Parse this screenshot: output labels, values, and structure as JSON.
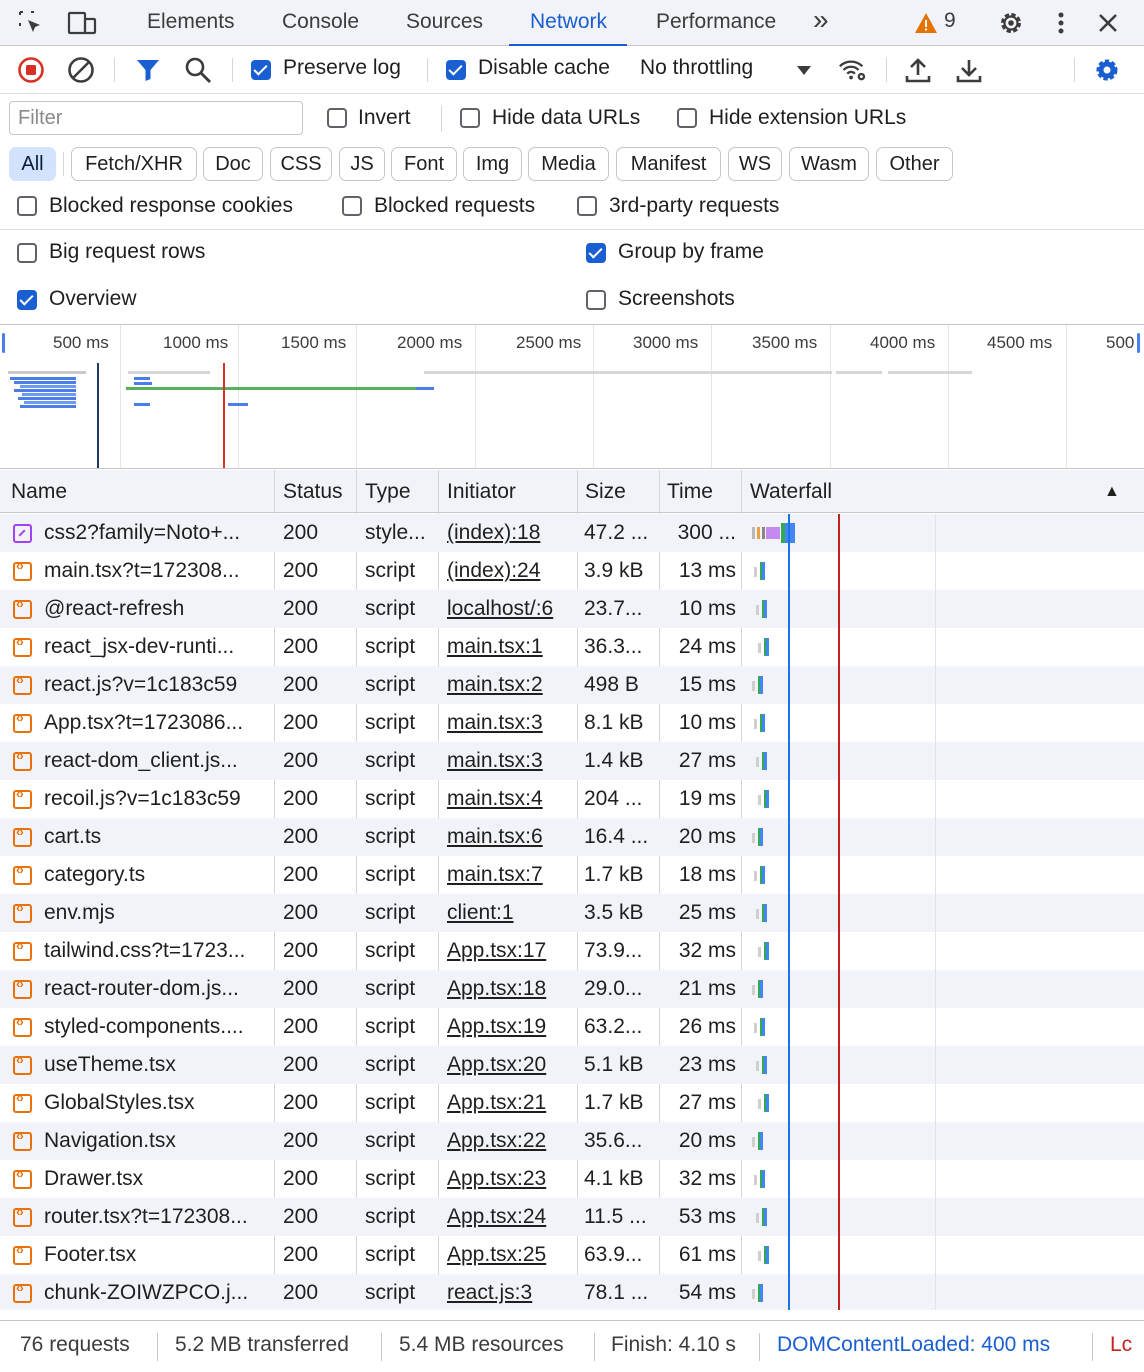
{
  "tabs": {
    "items": [
      "Elements",
      "Console",
      "Sources",
      "Network",
      "Performance"
    ],
    "active": "Network",
    "more_glyph": "»",
    "warning_count": "9",
    "icons": [
      "inspect-icon",
      "device-toggle-icon",
      "warning-icon",
      "gear-icon",
      "kebab-icon",
      "close-icon"
    ]
  },
  "toolbar": {
    "preserve_log": "Preserve log",
    "disable_cache": "Disable cache",
    "throttling": "No throttling",
    "preserve_log_checked": true,
    "disable_cache_checked": true
  },
  "filter": {
    "placeholder": "Filter",
    "invert": "Invert",
    "hide_data_urls": "Hide data URLs",
    "hide_extension_urls": "Hide extension URLs"
  },
  "chips": [
    "All",
    "Fetch/XHR",
    "Doc",
    "CSS",
    "JS",
    "Font",
    "Img",
    "Media",
    "Manifest",
    "WS",
    "Wasm",
    "Other"
  ],
  "active_chip": "All",
  "options": {
    "blocked_cookies": "Blocked response cookies",
    "blocked_requests": "Blocked requests",
    "third_party": "3rd-party requests",
    "big_rows": "Big request rows",
    "group_by_frame": "Group by frame",
    "overview": "Overview",
    "screenshots": "Screenshots",
    "group_by_frame_checked": true,
    "overview_checked": true
  },
  "overview_ticks": [
    "500 ms",
    "1000 ms",
    "1500 ms",
    "2000 ms",
    "2500 ms",
    "3000 ms",
    "3500 ms",
    "4000 ms",
    "4500 ms",
    "500"
  ],
  "columns": {
    "name": "Name",
    "status": "Status",
    "type": "Type",
    "initiator": "Initiator",
    "size": "Size",
    "time": "Time",
    "waterfall": "Waterfall"
  },
  "requests": [
    {
      "name": "css2?family=Noto+...",
      "status": "200",
      "type": "style...",
      "initiator": "(index):18",
      "size": "47.2 ...",
      "time": "300 ...",
      "kind": "css"
    },
    {
      "name": "main.tsx?t=172308...",
      "status": "200",
      "type": "script",
      "initiator": "(index):24",
      "size": "3.9 kB",
      "time": "13 ms",
      "kind": "script"
    },
    {
      "name": "@react-refresh",
      "status": "200",
      "type": "script",
      "initiator": "localhost/:6",
      "size": "23.7...",
      "time": "10 ms",
      "kind": "script"
    },
    {
      "name": "react_jsx-dev-runti...",
      "status": "200",
      "type": "script",
      "initiator": "main.tsx:1",
      "size": "36.3...",
      "time": "24 ms",
      "kind": "script"
    },
    {
      "name": "react.js?v=1c183c59",
      "status": "200",
      "type": "script",
      "initiator": "main.tsx:2",
      "size": "498 B",
      "time": "15 ms",
      "kind": "script"
    },
    {
      "name": "App.tsx?t=1723086...",
      "status": "200",
      "type": "script",
      "initiator": "main.tsx:3",
      "size": "8.1 kB",
      "time": "10 ms",
      "kind": "script"
    },
    {
      "name": "react-dom_client.js...",
      "status": "200",
      "type": "script",
      "initiator": "main.tsx:3",
      "size": "1.4 kB",
      "time": "27 ms",
      "kind": "script"
    },
    {
      "name": "recoil.js?v=1c183c59",
      "status": "200",
      "type": "script",
      "initiator": "main.tsx:4",
      "size": "204 ...",
      "time": "19 ms",
      "kind": "script"
    },
    {
      "name": "cart.ts",
      "status": "200",
      "type": "script",
      "initiator": "main.tsx:6",
      "size": "16.4 ...",
      "time": "20 ms",
      "kind": "script"
    },
    {
      "name": "category.ts",
      "status": "200",
      "type": "script",
      "initiator": "main.tsx:7",
      "size": "1.7 kB",
      "time": "18 ms",
      "kind": "script"
    },
    {
      "name": "env.mjs",
      "status": "200",
      "type": "script",
      "initiator": "client:1",
      "size": "3.5 kB",
      "time": "25 ms",
      "kind": "script"
    },
    {
      "name": "tailwind.css?t=1723...",
      "status": "200",
      "type": "script",
      "initiator": "App.tsx:17",
      "size": "73.9...",
      "time": "32 ms",
      "kind": "script"
    },
    {
      "name": "react-router-dom.js...",
      "status": "200",
      "type": "script",
      "initiator": "App.tsx:18",
      "size": "29.0...",
      "time": "21 ms",
      "kind": "script"
    },
    {
      "name": "styled-components....",
      "status": "200",
      "type": "script",
      "initiator": "App.tsx:19",
      "size": "63.2...",
      "time": "26 ms",
      "kind": "script"
    },
    {
      "name": "useTheme.tsx",
      "status": "200",
      "type": "script",
      "initiator": "App.tsx:20",
      "size": "5.1 kB",
      "time": "23 ms",
      "kind": "script"
    },
    {
      "name": "GlobalStyles.tsx",
      "status": "200",
      "type": "script",
      "initiator": "App.tsx:21",
      "size": "1.7 kB",
      "time": "27 ms",
      "kind": "script"
    },
    {
      "name": "Navigation.tsx",
      "status": "200",
      "type": "script",
      "initiator": "App.tsx:22",
      "size": "35.6...",
      "time": "20 ms",
      "kind": "script"
    },
    {
      "name": "Drawer.tsx",
      "status": "200",
      "type": "script",
      "initiator": "App.tsx:23",
      "size": "4.1 kB",
      "time": "32 ms",
      "kind": "script"
    },
    {
      "name": "router.tsx?t=172308...",
      "status": "200",
      "type": "script",
      "initiator": "App.tsx:24",
      "size": "11.5 ...",
      "time": "53 ms",
      "kind": "script"
    },
    {
      "name": "Footer.tsx",
      "status": "200",
      "type": "script",
      "initiator": "App.tsx:25",
      "size": "63.9...",
      "time": "61 ms",
      "kind": "script"
    },
    {
      "name": "chunk-ZOIWZPCO.j...",
      "status": "200",
      "type": "script",
      "initiator": "react.js:3",
      "size": "78.1 ...",
      "time": "54 ms",
      "kind": "script"
    }
  ],
  "status_bar": {
    "requests": "76 requests",
    "transferred": "5.2 MB transferred",
    "resources": "5.4 MB resources",
    "finish": "Finish: 4.10 s",
    "dom_content_loaded": "DOMContentLoaded: 400 ms",
    "load_truncated": "Lc"
  },
  "colors": {
    "accent": "#1a5fd1",
    "record": "#d93025",
    "dcl_line": "#1a73e8",
    "load_line": "#c5221f",
    "waiting": "#34a853",
    "download": "#4285f4"
  }
}
